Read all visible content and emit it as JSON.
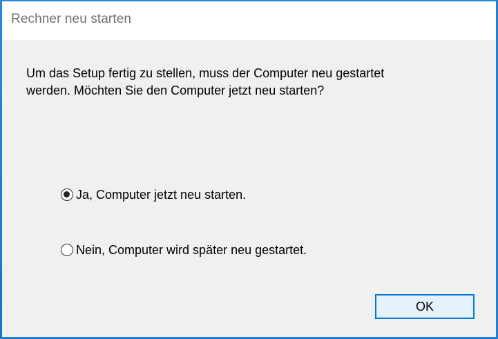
{
  "dialog": {
    "title": "Rechner neu starten",
    "message_line1": "Um das Setup fertig zu stellen, muss der Computer neu gestartet",
    "message_line2": "werden. Möchten Sie den Computer jetzt neu starten?",
    "options": [
      {
        "label": "Ja, Computer jetzt neu starten.",
        "selected": true
      },
      {
        "label": "Nein, Computer wird später neu gestartet.",
        "selected": false
      }
    ],
    "ok_label": "OK"
  },
  "colors": {
    "border_accent": "#1e7fd3",
    "button_border": "#0078d7",
    "button_fill": "#e5f1fb",
    "client_background": "#f0f0f0"
  },
  "icons": {
    "radio_selected": "radio-selected-icon",
    "radio_unselected": "radio-unselected-icon"
  }
}
